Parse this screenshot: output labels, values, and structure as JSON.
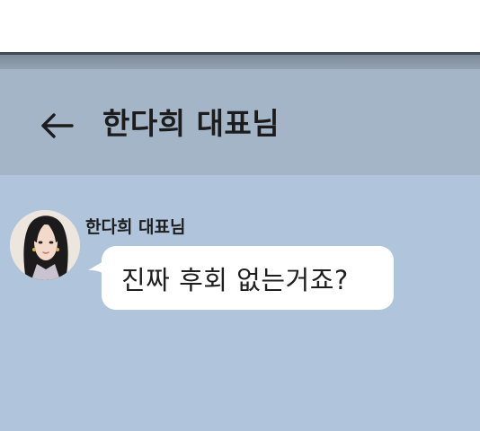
{
  "header": {
    "back_icon": "arrow-left-icon",
    "title": "한다희 대표님"
  },
  "message": {
    "avatar_icon": "profile-avatar",
    "sender": "한다희 대표님",
    "text": "진짜 후회 없는거죠?"
  },
  "colors": {
    "header_bg": "#a4b5c8",
    "chat_bg": "#b0c4dc",
    "bubble_bg": "#ffffff",
    "text": "#1e1e1e"
  }
}
